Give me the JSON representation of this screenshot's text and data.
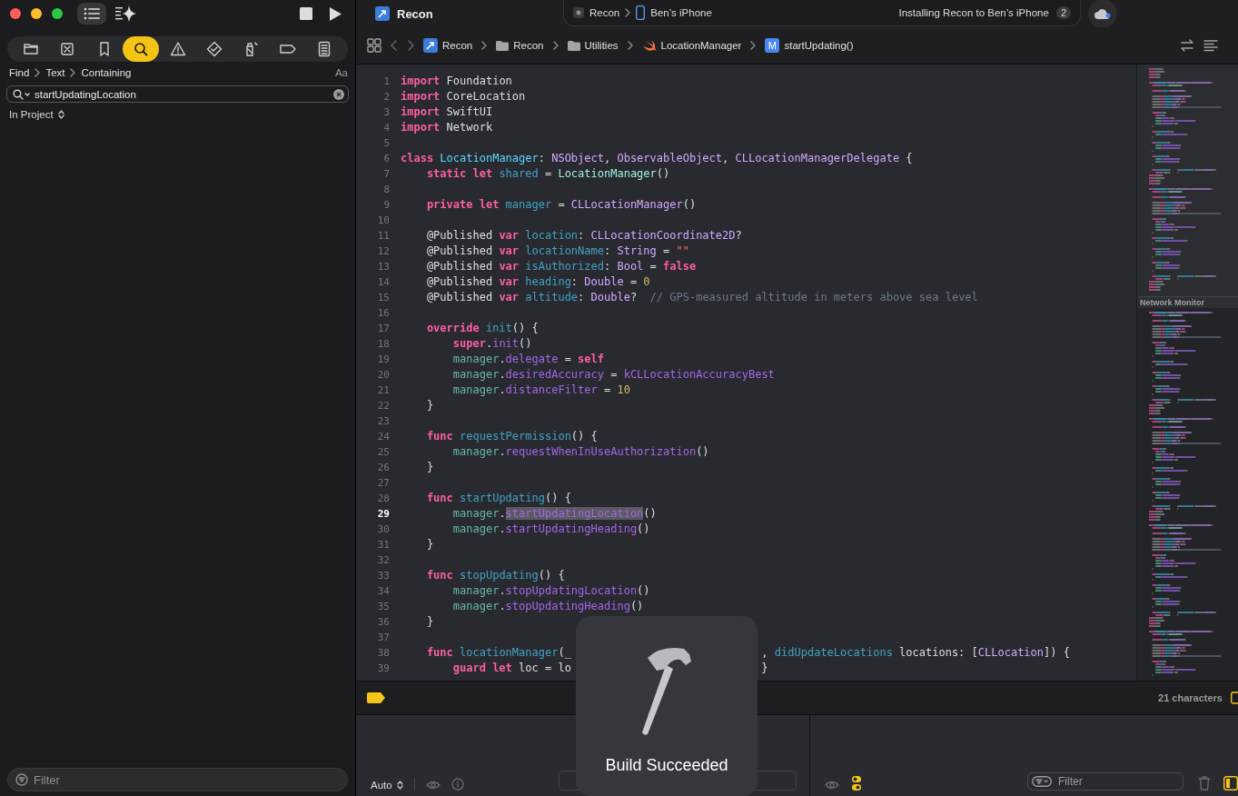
{
  "window": {
    "title": "Recon"
  },
  "sidebar": {
    "toolbar": [
      {
        "kind": "sidebar",
        "selected": true
      },
      {
        "kind": "assistant",
        "selected": false
      }
    ],
    "run_controls": [
      {
        "kind": "stop"
      },
      {
        "kind": "run"
      }
    ],
    "navigator_tabs": [
      {
        "kind": "folder",
        "selected": false
      },
      {
        "kind": "source-control",
        "selected": false
      },
      {
        "kind": "bookmark",
        "selected": false
      },
      {
        "kind": "search",
        "selected": true
      },
      {
        "kind": "issue",
        "selected": false
      },
      {
        "kind": "test",
        "selected": false
      },
      {
        "kind": "debug",
        "selected": false
      },
      {
        "kind": "breakpoint",
        "selected": false
      },
      {
        "kind": "report",
        "selected": false
      }
    ],
    "find_path": [
      "Find",
      "Text",
      "Containing"
    ],
    "case_toggle": "Aa",
    "search": {
      "value": "startUpdatingLocation"
    },
    "scope": "In Project",
    "filter": {
      "placeholder": "Filter"
    }
  },
  "activity": {
    "scheme": "Recon",
    "destination": "Ben’s iPhone",
    "status": "Installing Recon to Ben’s iPhone",
    "badge": "2"
  },
  "breadcrumbs": [
    {
      "kind": "app",
      "label": "Recon"
    },
    {
      "kind": "folder",
      "label": "Recon"
    },
    {
      "kind": "folder",
      "label": "Utilities"
    },
    {
      "kind": "swift",
      "label": "LocationManager"
    },
    {
      "kind": "method",
      "badge": "M",
      "label": "startUpdating()"
    }
  ],
  "editor": {
    "lines": [
      {
        "n": "1",
        "tokens": [
          {
            "text": "import ",
            "kind": "kw"
          },
          {
            "text": "Foundation",
            "kind": "plain"
          }
        ]
      },
      {
        "n": "2",
        "tokens": [
          {
            "text": "import ",
            "kind": "kw"
          },
          {
            "text": "CoreLocation",
            "kind": "plain"
          }
        ]
      },
      {
        "n": "3",
        "tokens": [
          {
            "text": "import ",
            "kind": "kw"
          },
          {
            "text": "SwiftUI",
            "kind": "plain"
          }
        ]
      },
      {
        "n": "4",
        "tokens": [
          {
            "text": "import ",
            "kind": "kw"
          },
          {
            "text": "Network",
            "kind": "plain"
          }
        ]
      },
      {
        "n": "5"
      },
      {
        "n": "6",
        "tokens": [
          {
            "text": "class ",
            "kind": "kw"
          },
          {
            "text": "LocationManager",
            "kind": "decl-type"
          },
          {
            "text": ": ",
            "kind": "plain"
          },
          {
            "text": "NSObject",
            "kind": "sys-type"
          },
          {
            "text": ", ",
            "kind": "plain"
          },
          {
            "text": "ObservableObject",
            "kind": "sys-type"
          },
          {
            "text": ", ",
            "kind": "plain"
          },
          {
            "text": "CLLocationManagerDelegate",
            "kind": "sys-type"
          },
          {
            "text": " {",
            "kind": "plain"
          }
        ]
      },
      {
        "n": "7",
        "tokens": [
          {
            "text": "    static let ",
            "kind": "kw"
          },
          {
            "text": "shared",
            "kind": "decl-other"
          },
          {
            "text": " = ",
            "kind": "plain"
          },
          {
            "text": "LocationManager",
            "kind": "proj-type"
          },
          {
            "text": "()",
            "kind": "plain"
          }
        ]
      },
      {
        "n": "8"
      },
      {
        "n": "9",
        "tokens": [
          {
            "text": "    private let ",
            "kind": "kw"
          },
          {
            "text": "manager",
            "kind": "decl-other"
          },
          {
            "text": " = ",
            "kind": "plain"
          },
          {
            "text": "CLLocationManager",
            "kind": "sys-type"
          },
          {
            "text": "()",
            "kind": "plain"
          }
        ]
      },
      {
        "n": "10"
      },
      {
        "n": "11",
        "tokens": [
          {
            "text": "    @Published ",
            "kind": "plain"
          },
          {
            "text": "var ",
            "kind": "kw"
          },
          {
            "text": "location",
            "kind": "decl-other"
          },
          {
            "text": ": ",
            "kind": "plain"
          },
          {
            "text": "CLLocationCoordinate2D",
            "kind": "sys-type"
          },
          {
            "text": "?",
            "kind": "plain"
          }
        ]
      },
      {
        "n": "12",
        "tokens": [
          {
            "text": "    @Published ",
            "kind": "plain"
          },
          {
            "text": "var ",
            "kind": "kw"
          },
          {
            "text": "locationName",
            "kind": "decl-other"
          },
          {
            "text": ": ",
            "kind": "plain"
          },
          {
            "text": "String",
            "kind": "sys-type"
          },
          {
            "text": " = ",
            "kind": "plain"
          },
          {
            "text": "\"\"",
            "kind": "string"
          }
        ]
      },
      {
        "n": "13",
        "tokens": [
          {
            "text": "    @Published ",
            "kind": "plain"
          },
          {
            "text": "var ",
            "kind": "kw"
          },
          {
            "text": "isAuthorized",
            "kind": "decl-other"
          },
          {
            "text": ": ",
            "kind": "plain"
          },
          {
            "text": "Bool",
            "kind": "sys-type"
          },
          {
            "text": " = ",
            "kind": "plain"
          },
          {
            "text": "false",
            "kind": "kw"
          }
        ]
      },
      {
        "n": "14",
        "tokens": [
          {
            "text": "    @Published ",
            "kind": "plain"
          },
          {
            "text": "var ",
            "kind": "kw"
          },
          {
            "text": "heading",
            "kind": "decl-other"
          },
          {
            "text": ": ",
            "kind": "plain"
          },
          {
            "text": "Double",
            "kind": "sys-type"
          },
          {
            "text": " = ",
            "kind": "plain"
          },
          {
            "text": "0",
            "kind": "number"
          }
        ]
      },
      {
        "n": "15",
        "tokens": [
          {
            "text": "    @Published ",
            "kind": "plain"
          },
          {
            "text": "var ",
            "kind": "kw"
          },
          {
            "text": "altitude",
            "kind": "decl-other"
          },
          {
            "text": ": ",
            "kind": "plain"
          },
          {
            "text": "Double",
            "kind": "sys-type"
          },
          {
            "text": "?  ",
            "kind": "plain"
          },
          {
            "text": "// GPS-measured altitude in meters above sea level",
            "kind": "comment"
          }
        ]
      },
      {
        "n": "16"
      },
      {
        "n": "17",
        "tokens": [
          {
            "text": "    override ",
            "kind": "kw"
          },
          {
            "text": "init",
            "kind": "decl-other"
          },
          {
            "text": "() {",
            "kind": "plain"
          }
        ]
      },
      {
        "n": "18",
        "tokens": [
          {
            "text": "        super",
            "kind": "kw"
          },
          {
            "text": ".",
            "kind": "plain"
          },
          {
            "text": "init",
            "kind": "sys-member"
          },
          {
            "text": "()",
            "kind": "plain"
          }
        ]
      },
      {
        "n": "19",
        "tokens": [
          {
            "text": "        manager",
            "kind": "proj-member"
          },
          {
            "text": ".",
            "kind": "plain"
          },
          {
            "text": "delegate",
            "kind": "sys-member"
          },
          {
            "text": " = ",
            "kind": "plain"
          },
          {
            "text": "self",
            "kind": "kw"
          }
        ]
      },
      {
        "n": "20",
        "tokens": [
          {
            "text": "        manager",
            "kind": "proj-member"
          },
          {
            "text": ".",
            "kind": "plain"
          },
          {
            "text": "desiredAccuracy",
            "kind": "sys-member"
          },
          {
            "text": " = ",
            "kind": "plain"
          },
          {
            "text": "kCLLocationAccuracyBest",
            "kind": "sys-member"
          }
        ]
      },
      {
        "n": "21",
        "tokens": [
          {
            "text": "        manager",
            "kind": "proj-member"
          },
          {
            "text": ".",
            "kind": "plain"
          },
          {
            "text": "distanceFilter",
            "kind": "sys-member"
          },
          {
            "text": " = ",
            "kind": "plain"
          },
          {
            "text": "10",
            "kind": "number"
          }
        ]
      },
      {
        "n": "22",
        "tokens": [
          {
            "text": "    }",
            "kind": "plain"
          }
        ]
      },
      {
        "n": "23"
      },
      {
        "n": "24",
        "tokens": [
          {
            "text": "    func ",
            "kind": "kw"
          },
          {
            "text": "requestPermission",
            "kind": "decl-other"
          },
          {
            "text": "() {",
            "kind": "plain"
          }
        ]
      },
      {
        "n": "25",
        "tokens": [
          {
            "text": "        manager",
            "kind": "proj-member"
          },
          {
            "text": ".",
            "kind": "plain"
          },
          {
            "text": "requestWhenInUseAuthorization",
            "kind": "sys-member"
          },
          {
            "text": "()",
            "kind": "plain"
          }
        ]
      },
      {
        "n": "26",
        "tokens": [
          {
            "text": "    }",
            "kind": "plain"
          }
        ]
      },
      {
        "n": "27"
      },
      {
        "n": "28",
        "tokens": [
          {
            "text": "    func ",
            "kind": "kw"
          },
          {
            "text": "startUpdating",
            "kind": "decl-other"
          },
          {
            "text": "() {",
            "kind": "plain"
          }
        ]
      },
      {
        "n": "29",
        "current": true,
        "tokens": [
          {
            "text": "        manager",
            "kind": "proj-member"
          },
          {
            "text": ".",
            "kind": "plain"
          },
          {
            "text": "startUpdatingLocation",
            "kind": "sys-member",
            "found": true
          },
          {
            "text": "()",
            "kind": "plain"
          }
        ]
      },
      {
        "n": "30",
        "tokens": [
          {
            "text": "        manager",
            "kind": "proj-member"
          },
          {
            "text": ".",
            "kind": "plain"
          },
          {
            "text": "startUpdatingHeading",
            "kind": "sys-member"
          },
          {
            "text": "()",
            "kind": "plain"
          }
        ]
      },
      {
        "n": "31",
        "tokens": [
          {
            "text": "    }",
            "kind": "plain"
          }
        ]
      },
      {
        "n": "32"
      },
      {
        "n": "33",
        "tokens": [
          {
            "text": "    func ",
            "kind": "kw"
          },
          {
            "text": "stopUpdating",
            "kind": "decl-other"
          },
          {
            "text": "() {",
            "kind": "plain"
          }
        ]
      },
      {
        "n": "34",
        "tokens": [
          {
            "text": "        manager",
            "kind": "proj-member"
          },
          {
            "text": ".",
            "kind": "plain"
          },
          {
            "text": "stopUpdatingLocation",
            "kind": "sys-member"
          },
          {
            "text": "()",
            "kind": "plain"
          }
        ]
      },
      {
        "n": "35",
        "tokens": [
          {
            "text": "        manager",
            "kind": "proj-member"
          },
          {
            "text": ".",
            "kind": "plain"
          },
          {
            "text": "stopUpdatingHeading",
            "kind": "sys-member"
          },
          {
            "text": "()",
            "kind": "plain"
          }
        ]
      },
      {
        "n": "36",
        "tokens": [
          {
            "text": "    }",
            "kind": "plain"
          }
        ]
      },
      {
        "n": "37"
      },
      {
        "n": "38",
        "tokens": [
          {
            "text": "    func ",
            "kind": "kw"
          },
          {
            "text": "locationManager",
            "kind": "decl-other"
          },
          {
            "text": "(_",
            "kind": "plain"
          },
          {
            "kind": "covered"
          },
          {
            "text": ", ",
            "kind": "plain"
          },
          {
            "text": "didUpdateLocations",
            "kind": "decl-other"
          },
          {
            "text": " locations: [",
            "kind": "plain"
          },
          {
            "text": "CLLocation",
            "kind": "sys-type"
          },
          {
            "text": "]) {",
            "kind": "plain"
          }
        ]
      },
      {
        "n": "39",
        "tokens": [
          {
            "text": "        guard let",
            "kind": "kw"
          },
          {
            "text": " loc = lo",
            "kind": "plain"
          },
          {
            "kind": "covered"
          },
          {
            "text": "}",
            "kind": "plain"
          }
        ]
      }
    ]
  },
  "minimap": {
    "section_label": "Network Monitor"
  },
  "hud": {
    "message": "Build Succeeded"
  },
  "debug_bar": {
    "selection_info": "21 characters"
  },
  "console_left": {
    "mode": "Auto"
  },
  "console_right": {
    "filter": {
      "placeholder": "Filter"
    }
  }
}
